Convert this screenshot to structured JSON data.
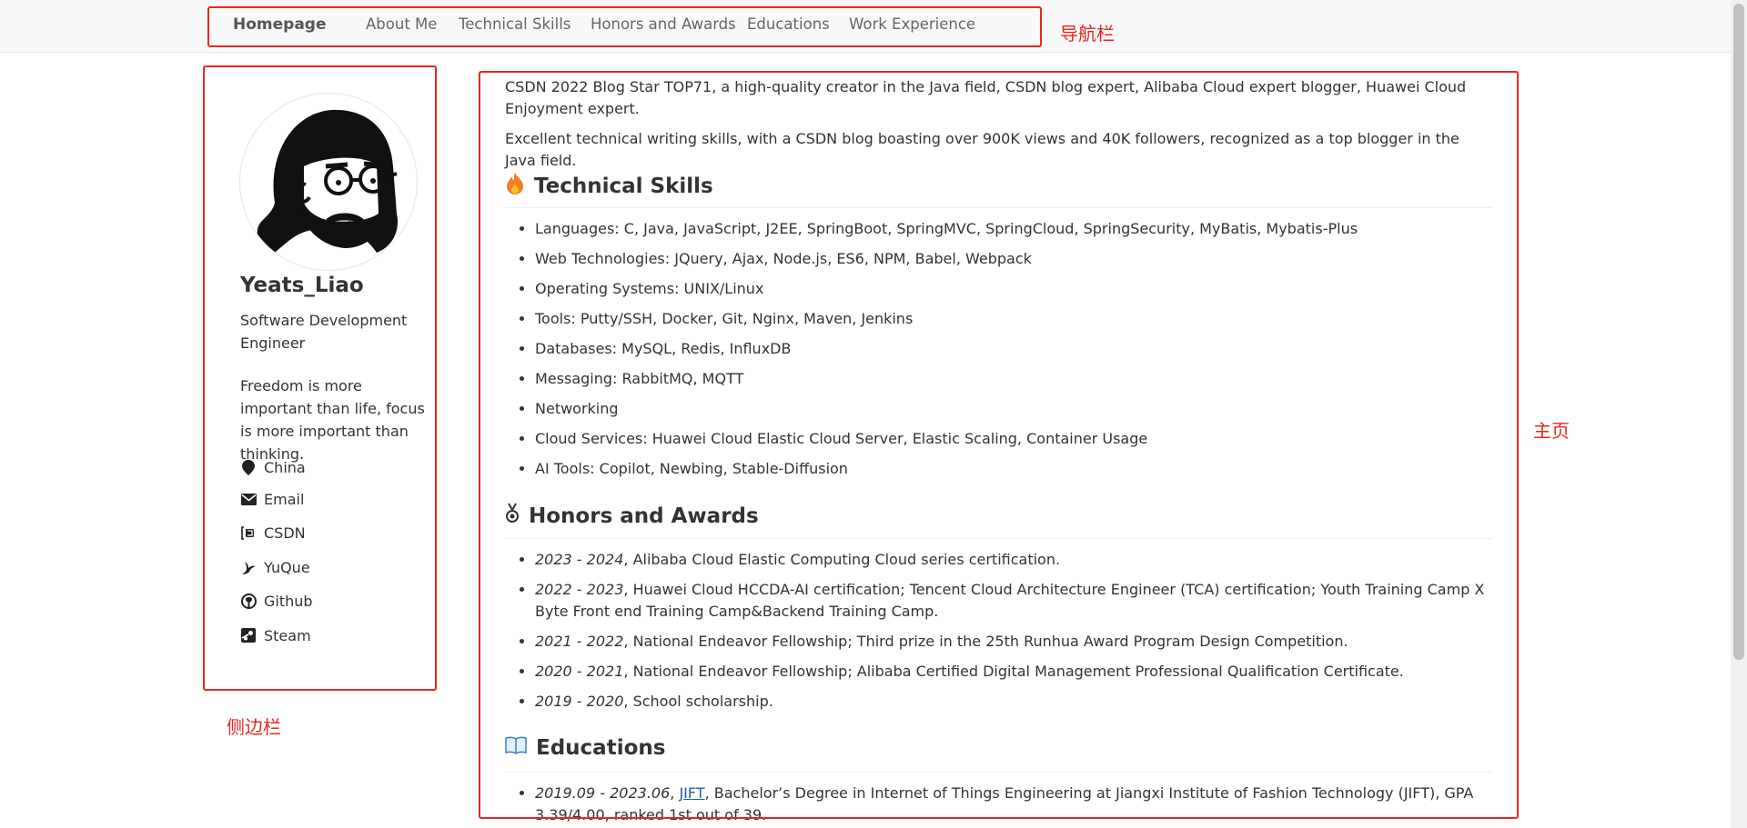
{
  "nav": {
    "brand": "Homepage",
    "links": [
      "About Me",
      "Technical Skills",
      "Honors and Awards",
      "Educations",
      "Work Experience"
    ]
  },
  "annotations": {
    "navbar": "导航栏",
    "sidebar": "侧边栏",
    "main": "主页",
    "color": "#e8251f"
  },
  "sidebar": {
    "name": "Yeats_Liao",
    "role": "Software Development Engineer",
    "bio": "Freedom is more important than life, focus is more important than thinking.",
    "links": [
      {
        "icon": "map-marker-icon",
        "label": "China"
      },
      {
        "icon": "envelope-icon",
        "label": "Email"
      },
      {
        "icon": "csdn-icon",
        "label": "CSDN"
      },
      {
        "icon": "yuque-icon",
        "label": "YuQue"
      },
      {
        "icon": "github-icon",
        "label": "Github"
      },
      {
        "icon": "steam-icon",
        "label": "Steam"
      }
    ]
  },
  "main": {
    "intro": [
      "CSDN 2022 Blog Star TOP71, a high-quality creator in the Java field, CSDN blog expert, Alibaba Cloud expert blogger, Huawei Cloud Enjoyment expert.",
      "Excellent technical writing skills, with a CSDN blog boasting over 900K views and 40K followers, recognized as a top blogger in the Java field."
    ],
    "skills": {
      "title": "Technical Skills",
      "icon": "fire-icon",
      "items": [
        "Languages: C, Java, JavaScript, J2EE, SpringBoot, SpringMVC, SpringCloud, SpringSecurity, MyBatis, Mybatis-Plus",
        "Web Technologies: JQuery, Ajax, Node.js, ES6, NPM, Babel, Webpack",
        "Operating Systems: UNIX/Linux",
        "Tools: Putty/SSH, Docker, Git, Nginx, Maven, Jenkins",
        "Databases: MySQL, Redis, InfluxDB",
        "Messaging: RabbitMQ, MQTT",
        "Networking",
        "Cloud Services: Huawei Cloud Elastic Cloud Server, Elastic Scaling, Container Usage",
        "AI Tools: Copilot, Newbing, Stable-Diffusion"
      ]
    },
    "honors": {
      "title": "Honors and Awards",
      "icon": "medal-icon",
      "items": [
        {
          "date": "2023 - 2024",
          "text": ", Alibaba Cloud Elastic Computing Cloud series certification."
        },
        {
          "date": "2022 - 2023",
          "text": ", Huawei Cloud HCCDA-AI certification; Tencent Cloud Architecture Engineer (TCA) certification; Youth Training Camp X Byte Front end Training Camp&Backend Training Camp."
        },
        {
          "date": "2021 - 2022",
          "text": ", National Endeavor Fellowship; Third prize in the 25th Runhua Award Program Design Competition."
        },
        {
          "date": "2020 - 2021",
          "text": ", National Endeavor Fellowship; Alibaba Certified Digital Management Professional Qualification Certificate."
        },
        {
          "date": "2019 - 2020",
          "text": ", School scholarship."
        }
      ]
    },
    "educations": {
      "title": "Educations",
      "icon": "book-icon",
      "items": [
        {
          "date": "2019.09 - 2023.06",
          "sep": ", ",
          "link": "JIFT",
          "text": ", Bachelor’s Degree in Internet of Things Engineering at Jiangxi Institute of Fashion Technology (JIFT), GPA 3.39/4.00, ranked 1st out of 39."
        }
      ]
    }
  }
}
